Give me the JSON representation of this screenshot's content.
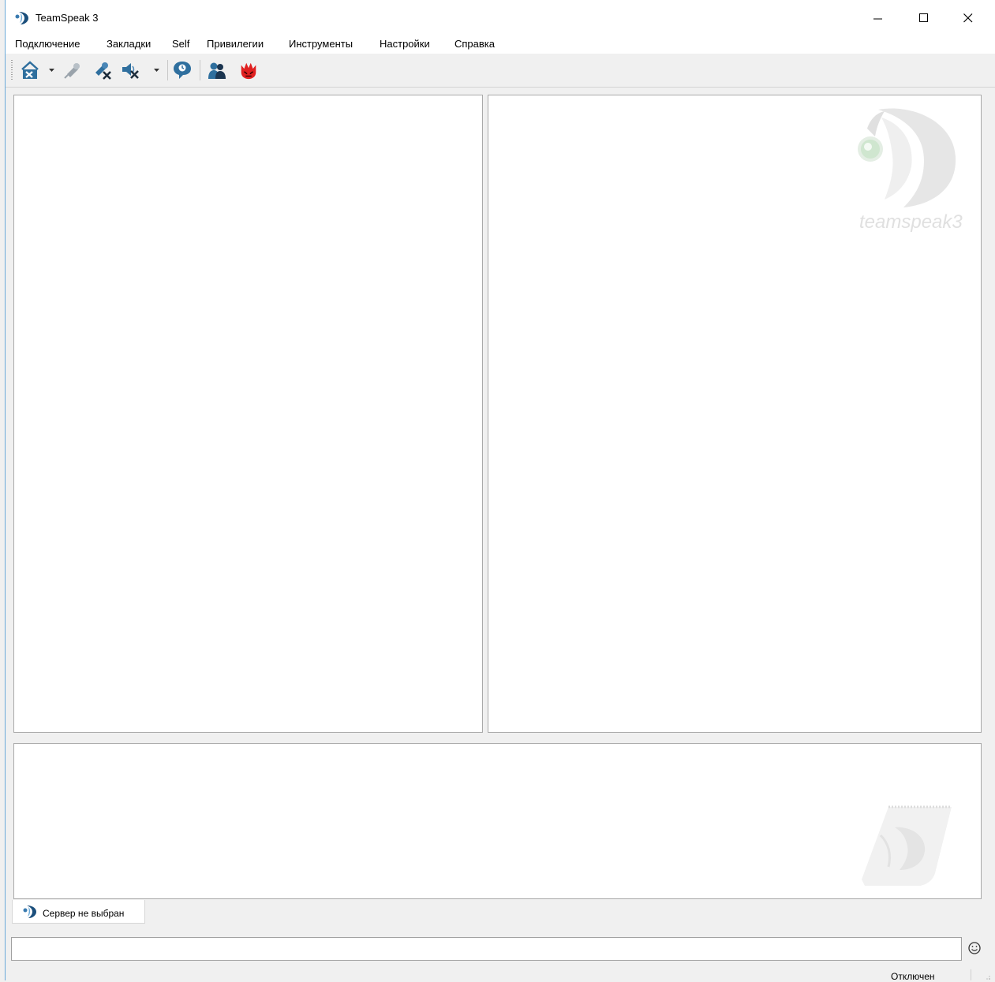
{
  "window": {
    "title": "TeamSpeak 3",
    "controls": [
      "minimize",
      "maximize",
      "close"
    ]
  },
  "menu": {
    "items": [
      "Подключение",
      "Закладки",
      "Self",
      "Привилегии",
      "Инструменты",
      "Настройки",
      "Справка"
    ]
  },
  "toolbar": {
    "buttons": [
      {
        "icon": "connect-disconnect-icon",
        "has_dropdown": true
      },
      {
        "icon": "microphone-toggle-icon",
        "has_dropdown": false
      },
      {
        "icon": "mute-microphone-icon",
        "has_dropdown": false
      },
      {
        "icon": "mute-speakers-icon",
        "has_dropdown": true
      },
      {
        "icon": "away-status-icon",
        "has_dropdown": false
      },
      {
        "icon": "contacts-icon",
        "has_dropdown": false
      },
      {
        "icon": "crash-reporter-icon",
        "has_dropdown": false
      }
    ]
  },
  "info_panel": {
    "watermark_text": "teamspeak3"
  },
  "server_tab": {
    "label": "Сервер не выбран"
  },
  "chat_input": {
    "value": "",
    "placeholder": ""
  },
  "status_bar": {
    "connection_status": "Отключен"
  },
  "colors": {
    "accent_blue": "#6aa9d8",
    "toolbar_icon_blue": "#2f6f9e",
    "crash_red": "#e02020"
  }
}
